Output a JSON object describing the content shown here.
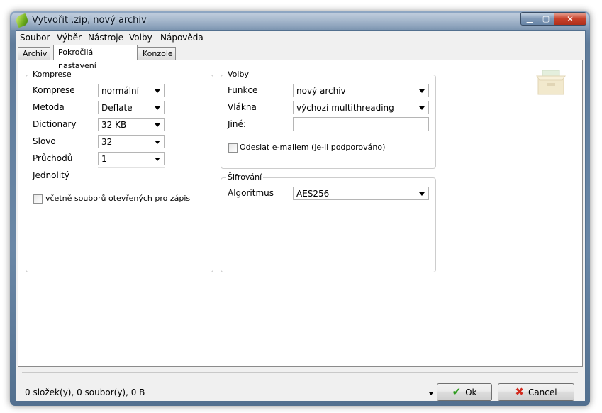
{
  "window": {
    "title": "Vytvořit .zip, nový archiv"
  },
  "menu": [
    "Soubor",
    "Výběr",
    "Nástroje",
    "Volby",
    "Nápověda"
  ],
  "tabs": [
    "Archiv",
    "Pokročilá nastavení",
    "Konzole"
  ],
  "active_tab": "Pokročilá nastavení",
  "komprese": {
    "title": "Komprese",
    "fields": [
      {
        "label": "Komprese",
        "value": "normální"
      },
      {
        "label": "Metoda",
        "value": "Deflate"
      },
      {
        "label": "Dictionary",
        "value": "32 KB"
      },
      {
        "label": "Slovo",
        "value": "32"
      },
      {
        "label": "Průchodů",
        "value": "1"
      },
      {
        "label": "Jednolitý",
        "value": ""
      }
    ],
    "checkbox_label": "včetně souborů otevřených pro zápis"
  },
  "volby": {
    "title": "Volby",
    "fields": [
      {
        "label": "Funkce",
        "value": "nový archiv"
      },
      {
        "label": "Vlákna",
        "value": "výchozí multithreading"
      },
      {
        "label": "Jiné:",
        "value": ""
      }
    ],
    "checkbox_label": "Odeslat e-mailem (je-li podporováno)"
  },
  "sifrovani": {
    "title": "Šifrování",
    "algorithm_label": "Algoritmus",
    "algorithm_value": "AES256"
  },
  "status": "0 složek(y), 0 soubor(y), 0 B",
  "buttons": {
    "ok": "Ok",
    "cancel": "Cancel"
  },
  "colors": {
    "ok_icon": "#2e9b1f",
    "cancel_icon": "#d22a1e",
    "close_button": "#c7412a"
  },
  "icons": [
    "app-leaf-icon",
    "minimize-icon",
    "maximize-icon",
    "close-icon",
    "archive-box-icon",
    "checkmark-icon",
    "x-cross-icon",
    "dropdown-arrow-icon"
  ]
}
